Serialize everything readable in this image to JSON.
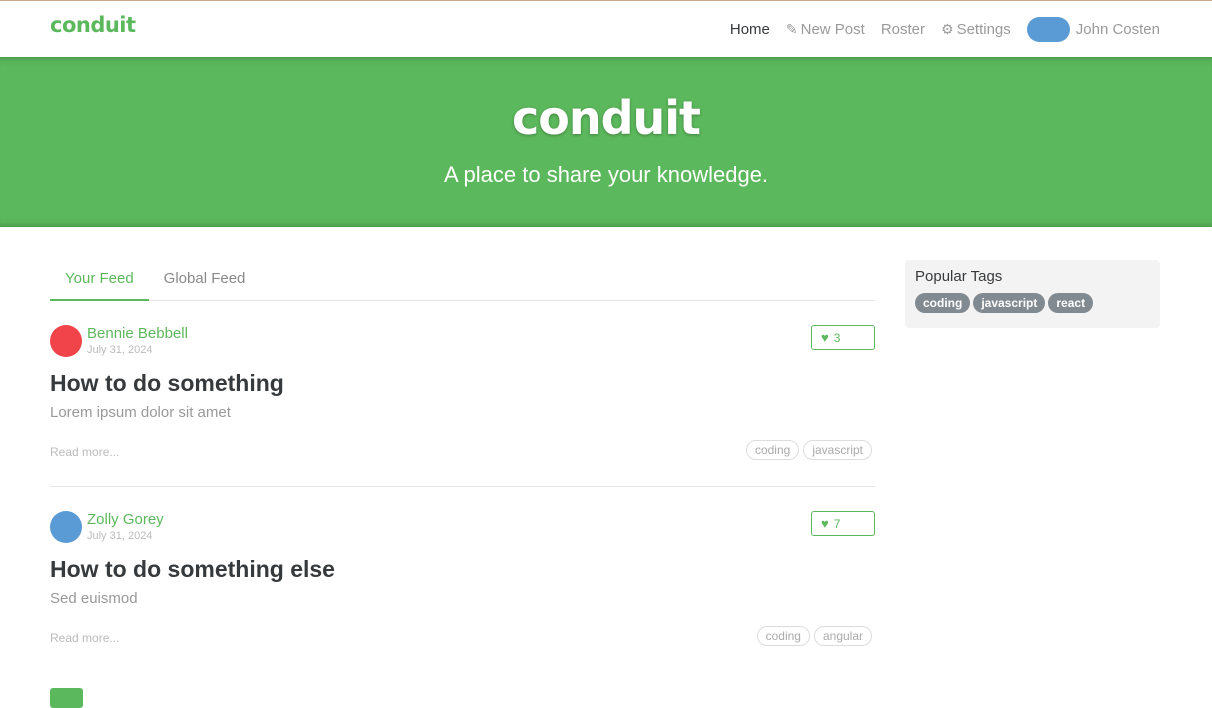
{
  "nav": {
    "brand": "conduit",
    "home": "Home",
    "new_post": "New Post",
    "roster": "Roster",
    "settings": "Settings",
    "user": "John Costen"
  },
  "banner": {
    "title": "conduit",
    "subtitle": "A place to share your knowledge."
  },
  "feed": {
    "tabs": [
      {
        "label": "Your Feed",
        "active": true
      },
      {
        "label": "Global Feed",
        "active": false
      }
    ],
    "articles": [
      {
        "author": "Bennie Bebbell",
        "date": "July 31, 2024",
        "avatar_color": "#f0434a",
        "favorites": "3",
        "title": "How to do something",
        "description": "Lorem ipsum dolor sit amet",
        "read_more": "Read more...",
        "tags": [
          "coding",
          "javascript"
        ]
      },
      {
        "author": "Zolly Gorey",
        "date": "July 31, 2024",
        "avatar_color": "#5b9bd5",
        "favorites": "7",
        "title": "How to do something else",
        "description": "Sed euismod",
        "read_more": "Read more...",
        "tags": [
          "coding",
          "angular"
        ]
      }
    ]
  },
  "sidebar": {
    "title": "Popular Tags",
    "tags": [
      "coding",
      "javascript",
      "react"
    ]
  },
  "colors": {
    "brand_green": "#5cb85c",
    "tag_gray": "#818a91"
  },
  "icons": {
    "new_post": "edit-icon",
    "settings": "gear-icon",
    "favorite": "heart-icon"
  }
}
